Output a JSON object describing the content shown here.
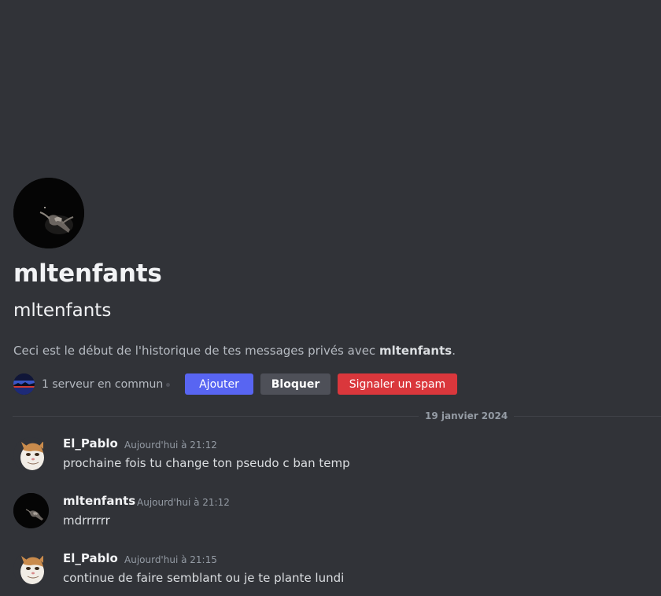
{
  "profile": {
    "display_name": "mltenfants",
    "username": "mltenfants",
    "intro_prefix": "Ceci est le début de l'historique de tes messages privés avec ",
    "intro_name": "mltenfants",
    "intro_suffix": ".",
    "mutual_servers": "1 serveur en commun"
  },
  "actions": {
    "add_label": "Ajouter",
    "block_label": "Bloquer",
    "spam_label": "Signaler un spam"
  },
  "date_divider": "19 janvier 2024",
  "messages": [
    {
      "author": "El_Pablo",
      "time": "Aujourd'hui à 21:12",
      "text": "prochaine fois tu change ton pseudo c ban temp",
      "avatar": "cat-avatar"
    },
    {
      "author": "mltenfants",
      "time": "Aujourd'hui à 21:12",
      "text": "mdrrrrrr",
      "avatar": "dark-avatar"
    },
    {
      "author": "El_Pablo",
      "time": "Aujourd'hui à 21:15",
      "text": "continue de faire semblant ou je te plante lundi",
      "avatar": "cat-avatar"
    }
  ],
  "colors": {
    "background": "#313338",
    "primary_button": "#5865f2",
    "secondary_button": "#4e5058",
    "danger_button": "#da373c"
  }
}
